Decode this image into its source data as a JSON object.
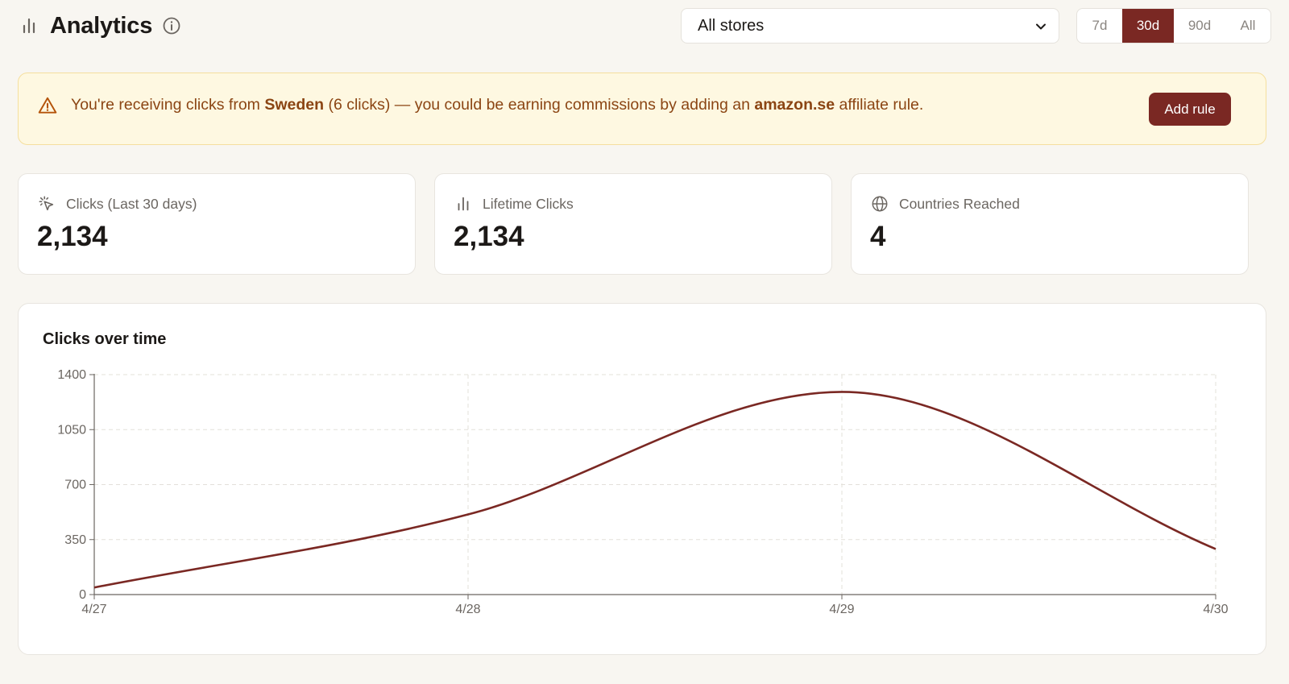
{
  "header": {
    "title": "Analytics",
    "store_select": {
      "value": "All stores"
    },
    "ranges": [
      {
        "label": "7d",
        "active": false
      },
      {
        "label": "30d",
        "active": true
      },
      {
        "label": "90d",
        "active": false
      },
      {
        "label": "All",
        "active": false
      }
    ]
  },
  "alert": {
    "text_1": "You're receiving clicks from ",
    "country": "Sweden",
    "text_2": " (6 clicks) — you could be earning commissions by adding an ",
    "domain": "amazon.se",
    "text_3": " affiliate rule.",
    "button_label": "Add rule"
  },
  "stats": [
    {
      "label": "Clicks (Last 30 days)",
      "value": "2,134",
      "icon": "cursor-click-icon"
    },
    {
      "label": "Lifetime Clicks",
      "value": "2,134",
      "icon": "bar-chart-icon"
    },
    {
      "label": "Countries Reached",
      "value": "4",
      "icon": "globe-icon"
    }
  ],
  "colors": {
    "accent": "#7a2823",
    "alert_bg": "#fef8e1",
    "alert_text": "#8b4513"
  },
  "chart_data": {
    "type": "line",
    "title": "Clicks over time",
    "categories": [
      "4/27",
      "4/28",
      "4/29",
      "4/30"
    ],
    "series": [
      {
        "values": [
          45,
          510,
          1290,
          290
        ]
      }
    ],
    "ylim": [
      0,
      1400
    ],
    "yticks": [
      "0",
      "350",
      "700",
      "1050",
      "1400"
    ],
    "grid": true,
    "curve": "smooth"
  }
}
